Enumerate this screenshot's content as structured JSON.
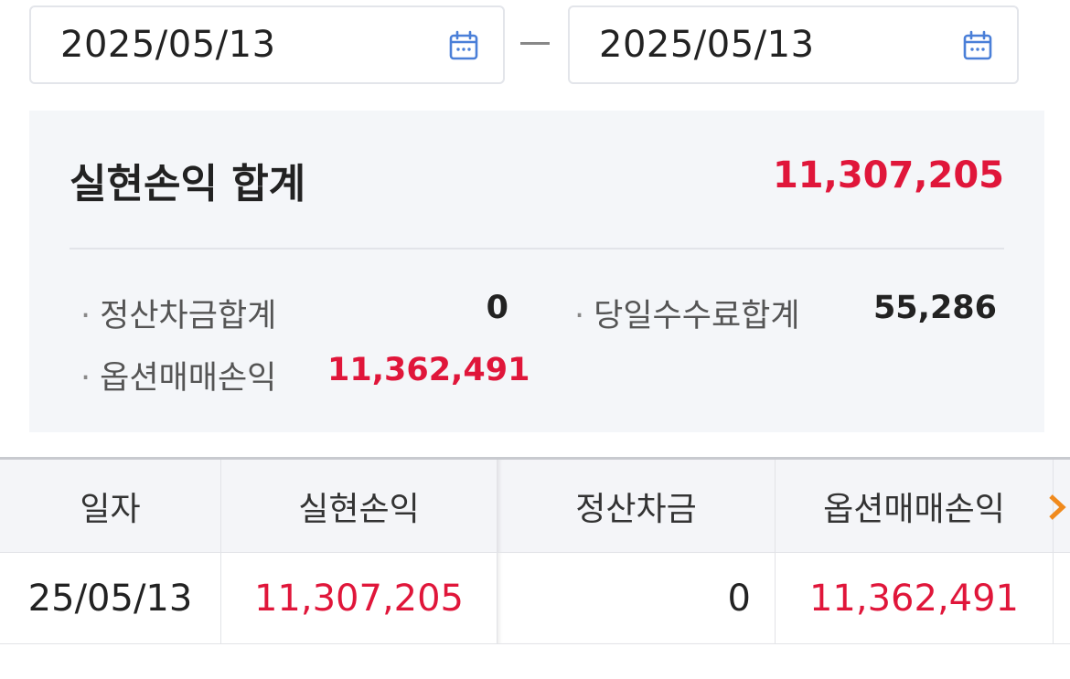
{
  "date_range": {
    "start": "2025/05/13",
    "end": "2025/05/13",
    "icon": "calendar-icon"
  },
  "summary": {
    "title": "실현손익 합계",
    "total": "11,307,205",
    "items": [
      {
        "label": "정산차금합계",
        "value": "0"
      },
      {
        "label": "당일수수료합계",
        "value": "55,286"
      },
      {
        "label": "옵션매매손익",
        "value": "11,362,491"
      }
    ],
    "bullet": "·"
  },
  "table": {
    "headers": [
      "일자",
      "실현손익",
      "정산차금",
      "옵션매매손익"
    ],
    "rows": [
      [
        "25/05/13",
        "11,307,205",
        "0",
        "11,362,491"
      ]
    ],
    "scroll_icon": "chevron-right-icon"
  },
  "colors": {
    "profit_red": "#e0163a",
    "accent_orange": "#f08a1d",
    "calendar_blue": "#4a7fd8"
  }
}
